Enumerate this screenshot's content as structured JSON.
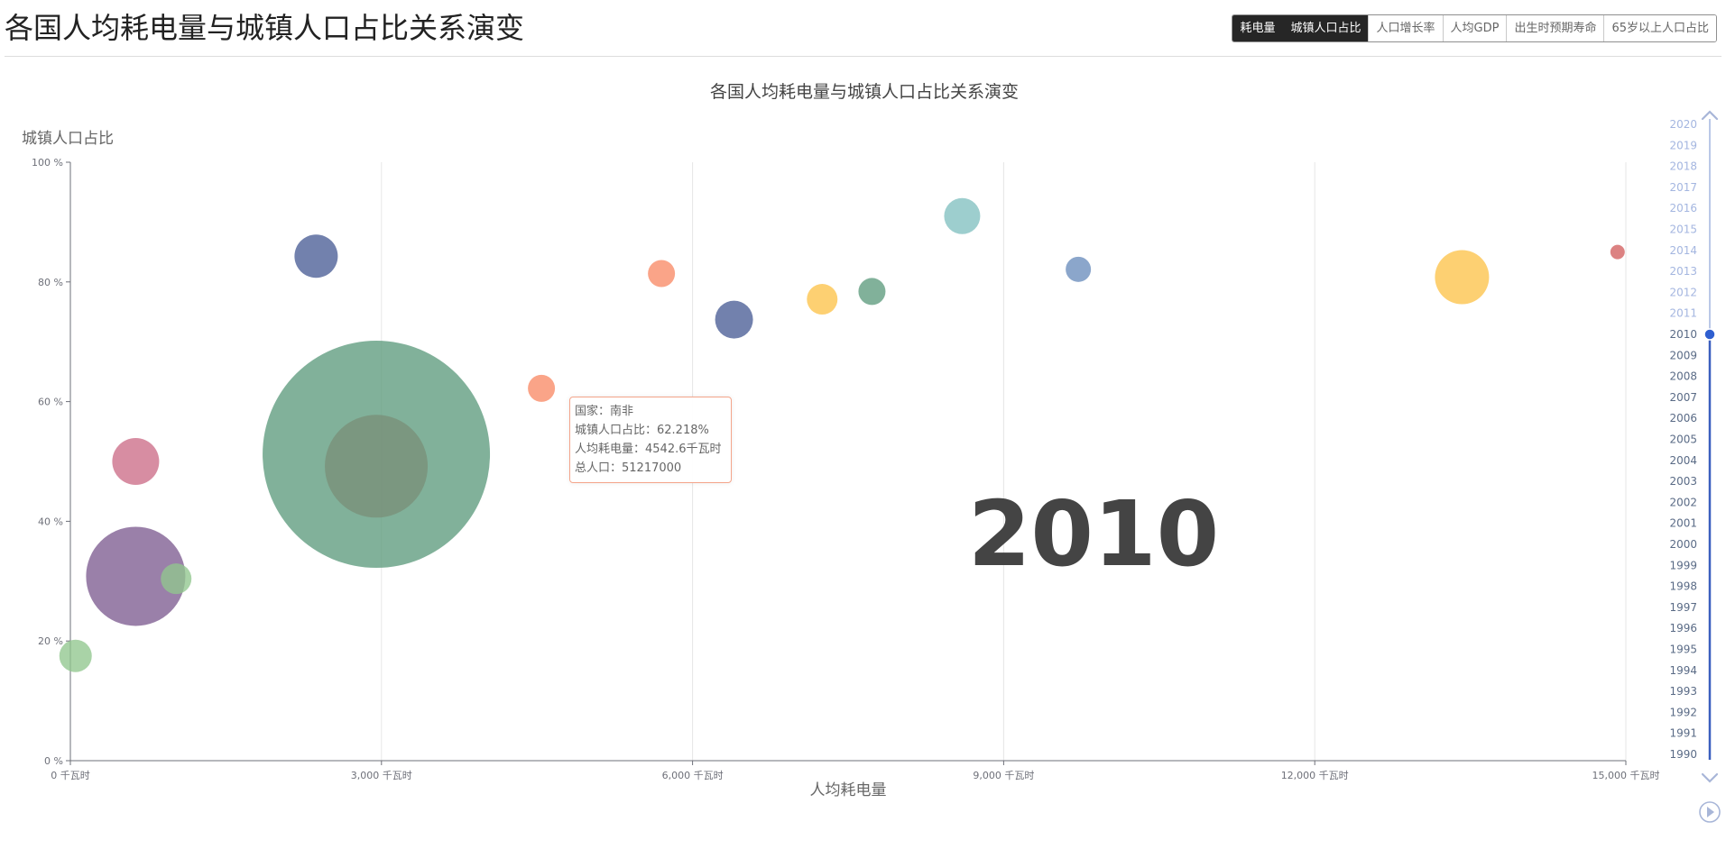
{
  "page": {
    "title": "各国人均耗电量与城镇人口占比关系演变"
  },
  "tabs": [
    {
      "label": "耗电量",
      "active": true
    },
    {
      "label": "城镇人口占比",
      "active": true
    },
    {
      "label": "人口增长率",
      "active": false
    },
    {
      "label": "人均GDP",
      "active": false
    },
    {
      "label": "出生时预期寿命",
      "active": false
    },
    {
      "label": "65岁以上人口占比",
      "active": false
    }
  ],
  "tooltip": {
    "line1": "国家：南非",
    "line2": "城镇人口占比：62.218%",
    "line3": "人均耗电量：4542.6千瓦时",
    "line4": "总人口：51217000"
  },
  "timeline": {
    "years": [
      "1990",
      "1991",
      "1992",
      "1993",
      "1994",
      "1995",
      "1996",
      "1997",
      "1998",
      "1999",
      "2000",
      "2001",
      "2002",
      "2003",
      "2004",
      "2005",
      "2006",
      "2007",
      "2008",
      "2009",
      "2010",
      "2011",
      "2012",
      "2013",
      "2014",
      "2015",
      "2016",
      "2017",
      "2018",
      "2019",
      "2020"
    ],
    "current": "2010",
    "colors": {
      "active": "#2f5fd0",
      "passed": "#3a5fbf",
      "future": "#a4b6e0",
      "control": "#a8b6d8"
    }
  },
  "chart_data": {
    "type": "scatter",
    "title": "各国人均耗电量与城镇人口占比关系演变",
    "xlabel": "人均耗电量",
    "ylabel": "城镇人口占比",
    "xlim": [
      0,
      15000
    ],
    "ylim": [
      0,
      100
    ],
    "x_ticks": [
      "0 千瓦时",
      "3,000 千瓦时",
      "6,000 千瓦时",
      "9,000 千瓦时",
      "12,000 千瓦时",
      "15,000 千瓦时"
    ],
    "x_tick_values": [
      0,
      3000,
      6000,
      9000,
      12000,
      15000
    ],
    "y_ticks": [
      "0 %",
      "20 %",
      "40 %",
      "60 %",
      "80 %",
      "100 %"
    ],
    "y_tick_values": [
      0,
      20,
      40,
      60,
      80,
      100
    ],
    "year_label": "2010",
    "grid": true,
    "points": [
      {
        "x": 50,
        "y": 17.5,
        "r": 18,
        "color": "#91c68e"
      },
      {
        "x": 630,
        "y": 30.8,
        "r": 55,
        "color": "#7d5c91"
      },
      {
        "x": 1020,
        "y": 30.4,
        "r": 17,
        "color": "#91c68e"
      },
      {
        "x": 630,
        "y": 50.0,
        "r": 26,
        "color": "#cc6d88"
      },
      {
        "x": 2950,
        "y": 51.2,
        "r": 126,
        "color": "#5d9b7e"
      },
      {
        "x": 2950,
        "y": 49.2,
        "r": 57,
        "color": "#7a8f79"
      },
      {
        "x": 2370,
        "y": 84.3,
        "r": 24,
        "color": "#4a5e96"
      },
      {
        "x": 4542.6,
        "y": 62.218,
        "r": 15,
        "color": "#f98b66"
      },
      {
        "x": 5700,
        "y": 81.4,
        "r": 15,
        "color": "#f98b66"
      },
      {
        "x": 6400,
        "y": 73.7,
        "r": 21,
        "color": "#4a5e96"
      },
      {
        "x": 7250,
        "y": 77.1,
        "r": 17,
        "color": "#fdc34a"
      },
      {
        "x": 7730,
        "y": 78.4,
        "r": 15,
        "color": "#5d9b7e"
      },
      {
        "x": 8600,
        "y": 91.0,
        "r": 20,
        "color": "#82c0c0"
      },
      {
        "x": 9720,
        "y": 82.1,
        "r": 14,
        "color": "#6a8dbd"
      },
      {
        "x": 13420,
        "y": 80.8,
        "r": 30,
        "color": "#fdc34a"
      },
      {
        "x": 14920,
        "y": 85.0,
        "r": 8,
        "color": "#d25f5f"
      }
    ]
  }
}
